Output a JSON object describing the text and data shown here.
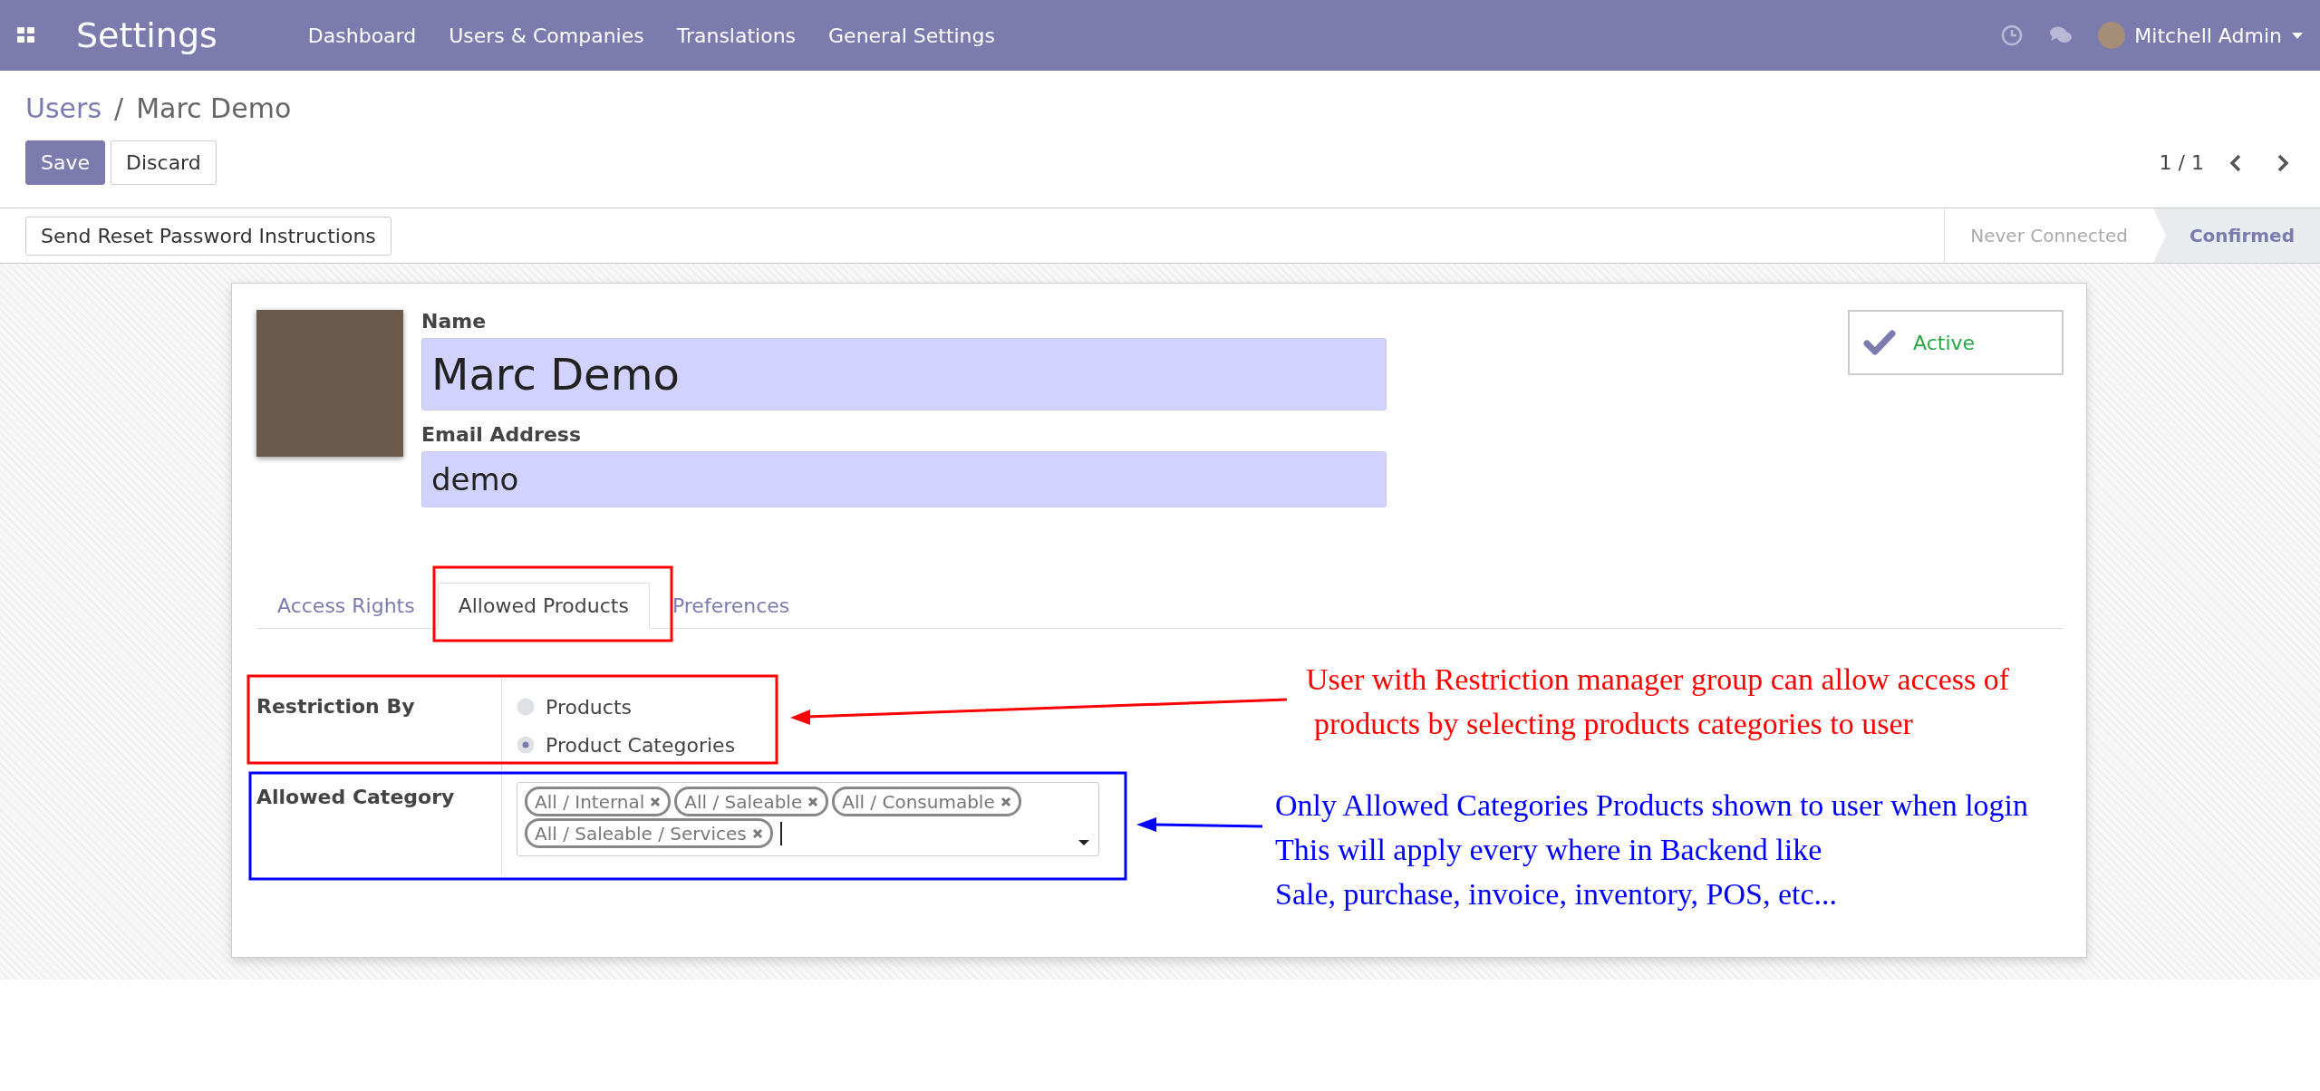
{
  "navbar": {
    "app_title": "Settings",
    "menu": [
      "Dashboard",
      "Users & Companies",
      "Translations",
      "General Settings"
    ],
    "user": "Mitchell Admin"
  },
  "breadcrumb": {
    "parent": "Users",
    "separator": "/",
    "current": "Marc Demo"
  },
  "buttons": [
    {
      "label": "Save",
      "kind": "primary"
    },
    {
      "label": "Discard",
      "kind": "secondary"
    }
  ],
  "pager": {
    "text": "1 / 1"
  },
  "header_buttons": [
    "Send Reset Password Instructions"
  ],
  "statusbar": [
    {
      "label": "Never Connected",
      "selected": false
    },
    {
      "label": "Confirmed",
      "selected": true
    }
  ],
  "form": {
    "name_label": "Name",
    "name_value": "Marc Demo",
    "email_label": "Email Address",
    "email_value": "demo",
    "active": {
      "label": "Active",
      "checked": true
    }
  },
  "tabs": [
    {
      "label": "Access Rights",
      "selected": false
    },
    {
      "label": "Allowed Products",
      "selected": true
    },
    {
      "label": "Preferences",
      "selected": false
    }
  ],
  "restriction": {
    "label": "Restriction By",
    "options": [
      {
        "label": "Products",
        "selected": false
      },
      {
        "label": "Product Categories",
        "selected": true
      }
    ]
  },
  "allowed_category": {
    "label": "Allowed Category",
    "tags": [
      "All / Internal",
      "All / Saleable",
      "All / Consumable",
      "All / Saleable / Services"
    ]
  },
  "annotations": [
    {
      "color": "#ff0000",
      "lines": [
        "User with Restriction manager group can allow access of",
        "products by selecting products categories to user"
      ]
    },
    {
      "color": "#0000ff",
      "lines": [
        "Only Allowed Categories Products shown to user when login",
        "This will apply every where in Backend like",
        "Sale, purchase, invoice, inventory, POS, etc..."
      ]
    }
  ]
}
